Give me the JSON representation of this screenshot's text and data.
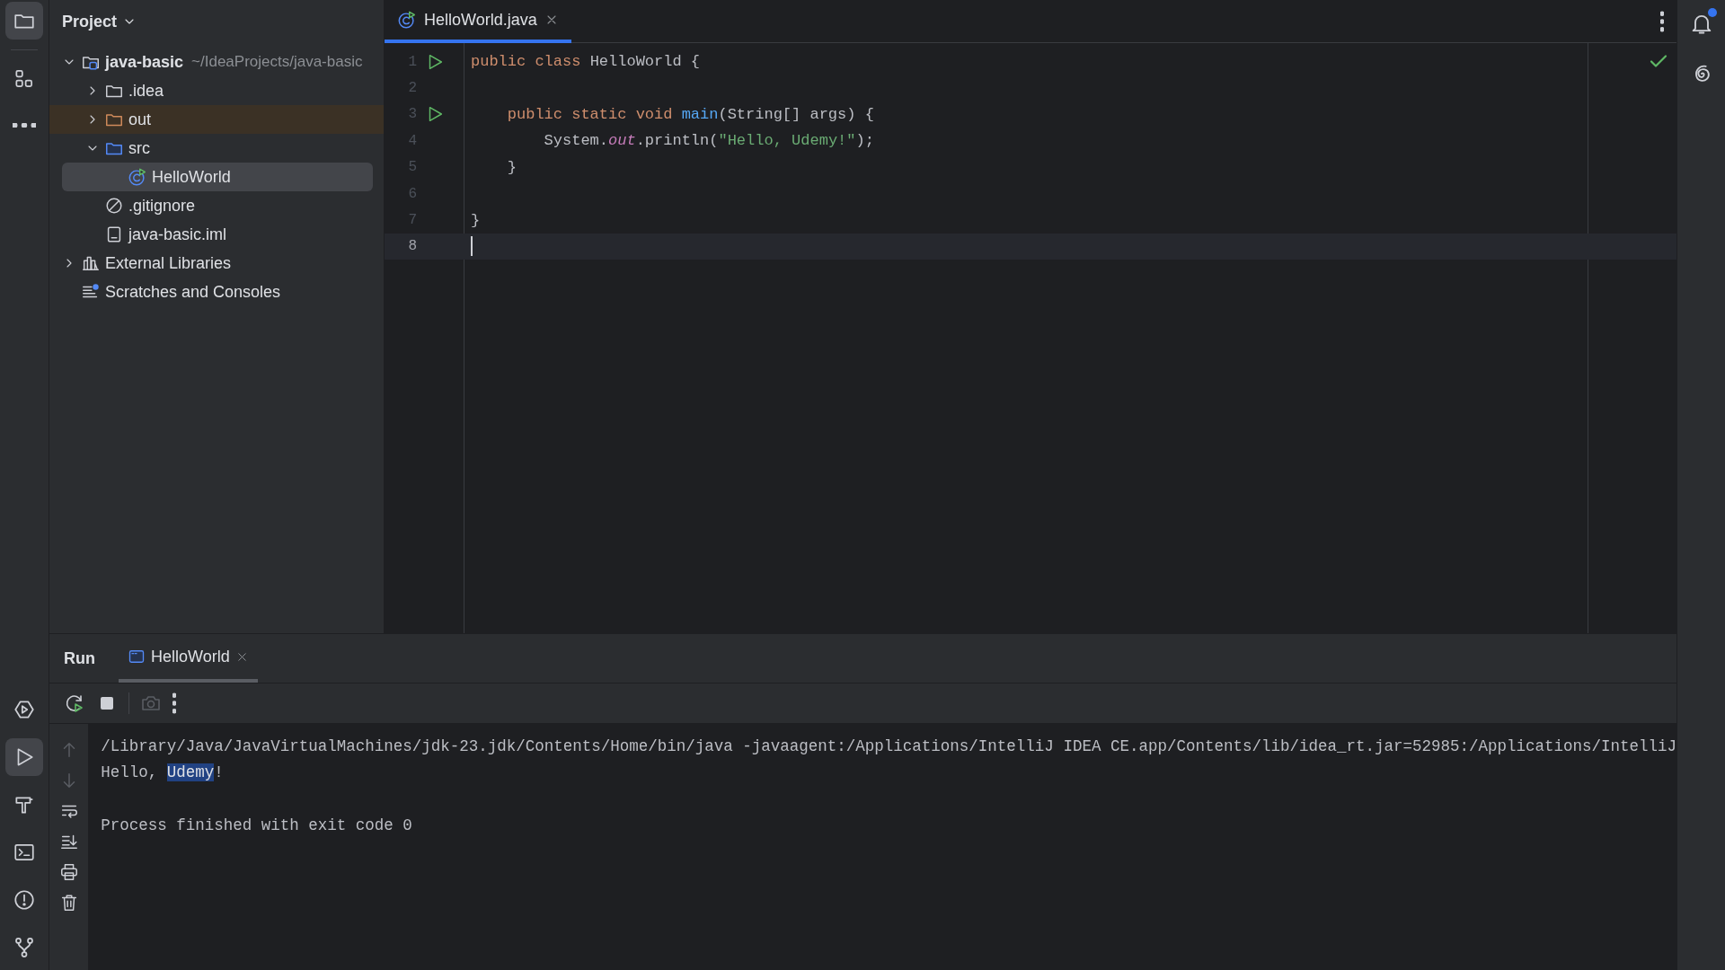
{
  "tool_strip": {
    "top": [
      {
        "kind": "project",
        "selected": true
      },
      {
        "kind": "structure",
        "selected": false
      },
      {
        "kind": "more",
        "selected": false
      }
    ],
    "bottom": [
      {
        "kind": "services",
        "selected": false
      },
      {
        "kind": "run",
        "selected": true
      },
      {
        "kind": "build",
        "selected": false
      },
      {
        "kind": "terminal",
        "selected": false
      },
      {
        "kind": "problems",
        "selected": false
      },
      {
        "kind": "git",
        "selected": false
      }
    ]
  },
  "project_panel": {
    "title": "Project",
    "tree": [
      {
        "kind": "module",
        "label": "java-basic",
        "hint": "~/IdeaProjects/java-basic",
        "expanded": true,
        "selected": false,
        "children": [
          {
            "kind": "folder",
            "label": ".idea",
            "expanded": false,
            "selected": false
          },
          {
            "kind": "excluded-folder",
            "label": "out",
            "expanded": false,
            "selected": false
          },
          {
            "kind": "source-folder",
            "label": "src",
            "expanded": true,
            "selected": false,
            "children": [
              {
                "kind": "class",
                "label": "HelloWorld",
                "selected": true
              }
            ]
          },
          {
            "kind": "ignore",
            "label": ".gitignore",
            "selected": false
          },
          {
            "kind": "iml",
            "label": "java-basic.iml",
            "selected": false
          }
        ]
      },
      {
        "kind": "libraries",
        "label": "External Libraries",
        "expanded": false,
        "selected": false
      },
      {
        "kind": "scratches",
        "label": "Scratches and Consoles",
        "selected": false
      }
    ]
  },
  "editor": {
    "tabs": [
      {
        "label": "HelloWorld.java",
        "selected": true
      }
    ],
    "lines": [
      {
        "number": "1",
        "run": true,
        "current": false,
        "tokens": [
          {
            "kind": "keyword",
            "text": "public class "
          },
          {
            "kind": "plain",
            "text": "HelloWorld {"
          }
        ]
      },
      {
        "number": "2",
        "run": false,
        "current": false
      },
      {
        "number": "3",
        "run": true,
        "current": false,
        "tokens": [
          {
            "kind": "keyword",
            "text": "    public static void "
          },
          {
            "kind": "method",
            "text": "main"
          },
          {
            "kind": "plain",
            "text": "(String[] args) {"
          }
        ]
      },
      {
        "number": "4",
        "run": false,
        "current": false,
        "tokens": [
          {
            "kind": "plain",
            "text": "        System."
          },
          {
            "kind": "field",
            "text": "out"
          },
          {
            "kind": "plain",
            "text": ".println("
          },
          {
            "kind": "string",
            "text": "\"Hello, Udemy!\""
          },
          {
            "kind": "plain",
            "text": ");"
          }
        ]
      },
      {
        "number": "5",
        "run": false,
        "current": false,
        "tokens": [
          {
            "kind": "plain",
            "text": "    }"
          }
        ]
      },
      {
        "number": "6",
        "run": false,
        "current": false
      },
      {
        "number": "7",
        "run": false,
        "current": false,
        "tokens": [
          {
            "kind": "plain",
            "text": "}"
          }
        ]
      },
      {
        "number": "8",
        "run": false,
        "current": true
      }
    ]
  },
  "run_panel": {
    "title": "Run",
    "tabs": [
      {
        "label": "HelloWorld",
        "selected": true
      }
    ],
    "toolbar": [
      {
        "kind": "rerun",
        "disabled": false
      },
      {
        "kind": "stop",
        "disabled": false
      },
      {
        "kind": "separator"
      },
      {
        "kind": "screenshot",
        "disabled": true
      },
      {
        "kind": "more",
        "disabled": false
      }
    ],
    "side_toolbar": [
      {
        "kind": "up",
        "disabled": true
      },
      {
        "kind": "down",
        "disabled": true
      },
      {
        "kind": "wrap",
        "disabled": false
      },
      {
        "kind": "scroll-end",
        "disabled": false
      },
      {
        "kind": "print",
        "disabled": false
      },
      {
        "kind": "clear",
        "disabled": false
      }
    ],
    "output": [
      {
        "kind": "text",
        "segments": [
          {
            "text": "/Library/Java/JavaVirtualMachines/jdk-23.jdk/Contents/Home/bin/java -javaagent:/Applications/IntelliJ IDEA CE.app/Contents/lib/idea_rt.jar=52985:/Applications/IntelliJ",
            "highlighted": false
          }
        ]
      },
      {
        "kind": "text",
        "segments": [
          {
            "text": "Hello, ",
            "highlighted": false
          },
          {
            "text": "Udemy",
            "highlighted": true
          },
          {
            "text": "!",
            "highlighted": false
          }
        ]
      },
      {
        "kind": "blank"
      },
      {
        "kind": "text",
        "segments": [
          {
            "text": "Process finished with exit code 0",
            "highlighted": false
          }
        ]
      }
    ]
  },
  "right_strip": [
    {
      "kind": "notifications",
      "badge": true
    },
    {
      "kind": "ai",
      "badge": false
    }
  ]
}
